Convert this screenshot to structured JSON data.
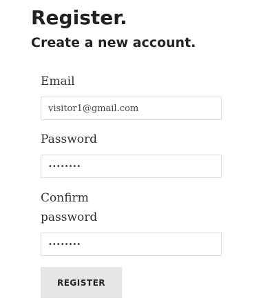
{
  "header": {
    "title": "Register.",
    "subtitle": "Create a new account."
  },
  "form": {
    "email": {
      "label": "Email",
      "value": "visitor1@gmail.com"
    },
    "password": {
      "label": "Password",
      "value": "••••••••"
    },
    "confirm_password": {
      "label_line1": "Confirm",
      "label_line2": "password",
      "value": "••••••••"
    },
    "submit_label": "REGISTER"
  }
}
